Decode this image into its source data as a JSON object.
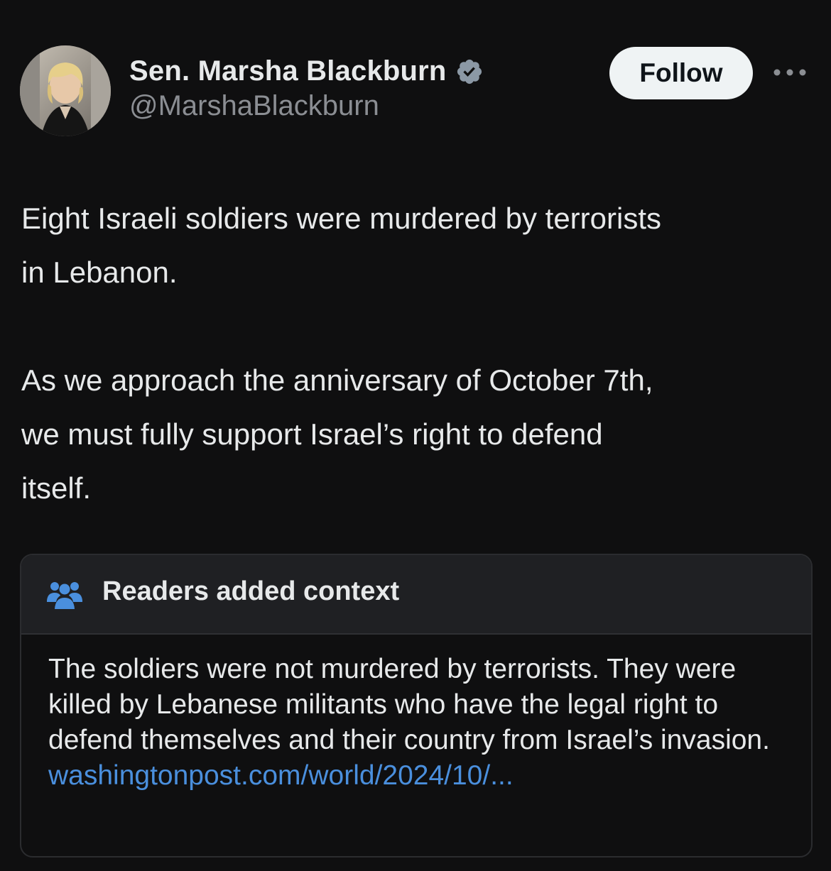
{
  "author": {
    "display_name": "Sen. Marsha Blackburn",
    "handle": "@MarshaBlackburn",
    "verified_icon": "verified-badge-icon",
    "verified_color": "#8b98a5"
  },
  "actions": {
    "follow_label": "Follow",
    "more_icon": "more-horizontal-icon"
  },
  "tweet": {
    "text": "Eight Israeli soldiers were murdered by terrorists\nin Lebanon.\n\nAs we approach the anniversary of October 7th,\nwe must fully support Israel’s right to defend\nitself."
  },
  "community_note": {
    "icon": "people-icon",
    "title": "Readers added context",
    "body": "The soldiers were not murdered by terrorists. They were killed by Lebanese militants who have the legal right to defend themselves and their country from Israel’s invasion.",
    "link_text": "washingtonpost.com/world/2024/10/..."
  },
  "colors": {
    "background": "#0f0f10",
    "text": "#e7e9ea",
    "secondary_text": "#8b8e93",
    "link": "#4a8fdd",
    "note_header_bg": "#1f2023",
    "people_icon": "#4a8fdd"
  }
}
